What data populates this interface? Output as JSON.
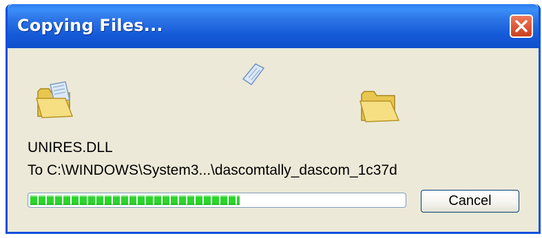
{
  "window": {
    "title": "Copying Files...",
    "close_icon": "close-icon",
    "title_color": "#ffffff",
    "titlebar_color": "#155ad8",
    "close_color": "#e0583a"
  },
  "animation": {
    "source_icon": "folder-with-document-icon",
    "transfer_icon": "flying-document-icon",
    "destination_icon": "open-folder-icon"
  },
  "file": {
    "name": "UNIRES.DLL",
    "destination": "To C:\\WINDOWS\\System3...\\dascomtally_dascom_1c37d"
  },
  "progress": {
    "value": 0.56,
    "fill_color": "#2cd52c"
  },
  "buttons": {
    "cancel_label": "Cancel"
  }
}
